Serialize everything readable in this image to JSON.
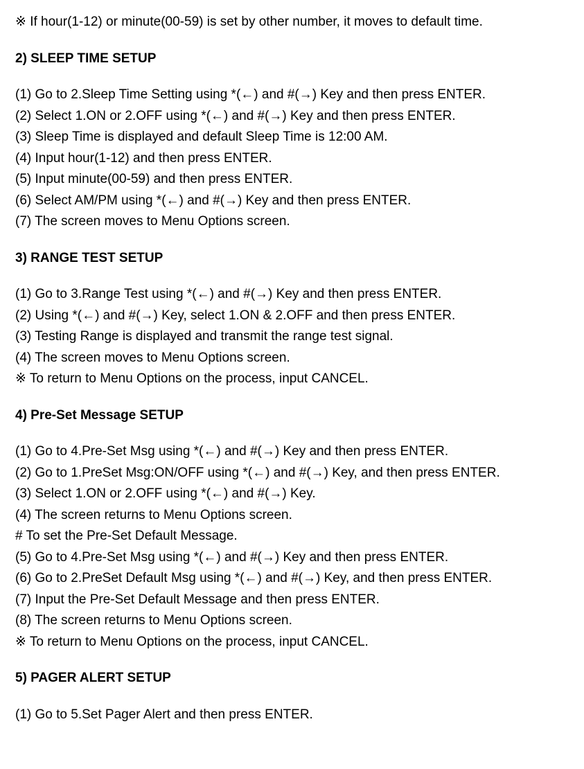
{
  "note_top": "※ If hour(1-12) or minute(00-59) is set by other number, it moves to default time.",
  "section2": {
    "title": "2) SLEEP TIME SETUP",
    "steps": [
      "(1) Go to 2.Sleep Time Setting using *(←) and #(→) Key and then press ENTER.",
      "(2) Select 1.ON or 2.OFF using *(←) and #(→) Key and then press ENTER.",
      "(3) Sleep Time is displayed and default Sleep Time is 12:00 AM.",
      "(4) Input hour(1-12) and then press ENTER.",
      "(5) Input minute(00-59) and then press ENTER.",
      "(6) Select AM/PM using *(←) and #(→) Key and then press ENTER.",
      "(7) The screen moves to Menu Options screen."
    ]
  },
  "section3": {
    "title": "3) RANGE TEST SETUP",
    "steps": [
      "(1) Go to 3.Range Test using *(←) and #(→) Key and then press ENTER.",
      "(2) Using *(←) and #(→) Key, select 1.ON & 2.OFF and then press ENTER.",
      "(3) Testing Range is displayed and transmit the range test signal.",
      "(4) The screen moves to Menu Options screen."
    ],
    "note": "※ To return to Menu Options on the process, input CANCEL."
  },
  "section4": {
    "title": "4) Pre-Set Message SETUP",
    "steps_a": [
      "(1) Go to 4.Pre-Set Msg using *(←) and #(→) Key and then press ENTER.",
      "(2) Go to 1.PreSet Msg:ON/OFF using *(←) and #(→) Key, and then press ENTER.",
      "(3) Select 1.ON or 2.OFF using *(←) and #(→) Key.",
      "(4) The screen returns to Menu Options screen."
    ],
    "sub_note": " # To set the Pre-Set Default Message.",
    "steps_b": [
      "(5) Go to 4.Pre-Set Msg using *(←) and #(→) Key and then press ENTER.",
      "(6) Go to 2.PreSet Default Msg using *(←) and #(→) Key, and then press ENTER.",
      "(7) Input the Pre-Set Default Message and then press ENTER.",
      "(8) The screen returns to Menu Options screen."
    ],
    "note": "※ To return to Menu Options on the process, input CANCEL."
  },
  "section5": {
    "title": "5) PAGER ALERT SETUP",
    "steps": [
      "(1) Go to 5.Set Pager Alert and then press ENTER."
    ]
  }
}
